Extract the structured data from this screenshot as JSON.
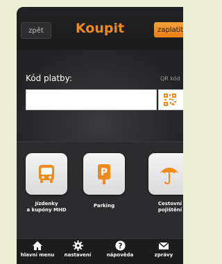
{
  "header": {
    "back_label": "zpět",
    "title": "Koupit",
    "pay_label": "zaplatit"
  },
  "form": {
    "code_label": "Kód platby:",
    "qr_label": "QR kód",
    "code_value": "",
    "code_placeholder": ""
  },
  "tiles": [
    {
      "label_line1": "Jízdenky",
      "label_line2": "a kupóny MHD",
      "icon": "bus-icon"
    },
    {
      "label_line1": "Parking",
      "label_line2": "",
      "icon": "parking-icon"
    },
    {
      "label_line1": "Cestovní",
      "label_line2": "pojištění",
      "icon": "umbrella-icon"
    }
  ],
  "tabs": [
    {
      "label": "hlavní menu",
      "icon": "home-icon"
    },
    {
      "label": "nastavení",
      "icon": "gear-icon"
    },
    {
      "label": "nápověda",
      "icon": "help-icon"
    },
    {
      "label": "zprávy",
      "icon": "envelope-icon"
    }
  ],
  "colors": {
    "accent": "#f08a1c",
    "background": "#2a2a2c",
    "page": "#eef0d6"
  }
}
